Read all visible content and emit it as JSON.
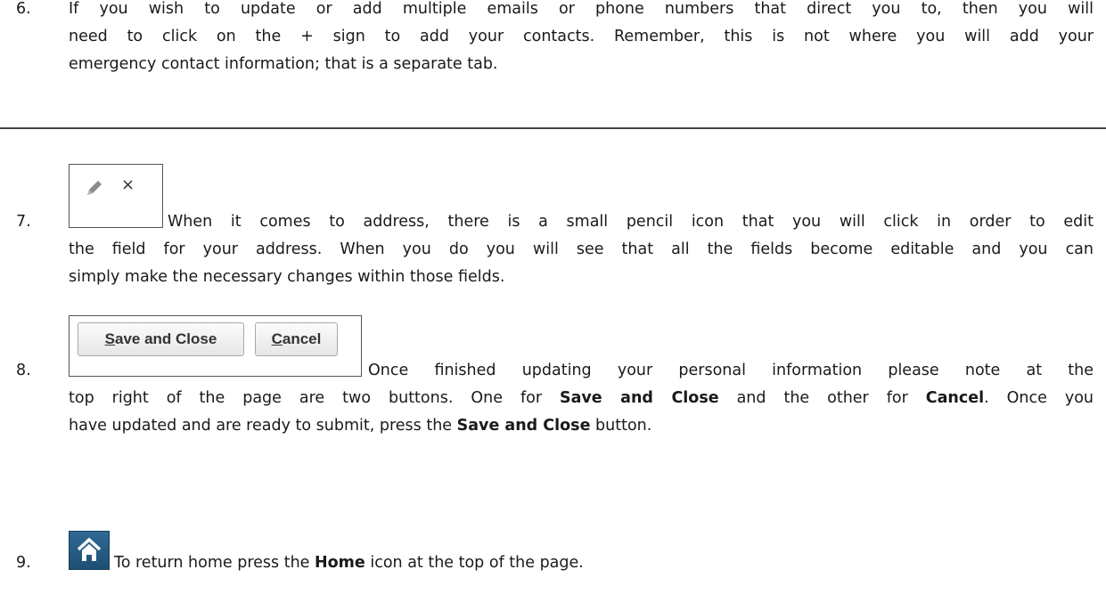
{
  "steps": [
    {
      "number": "6.",
      "lines": [
        "If you wish to update or add multiple emails or phone numbers that direct you to, then you will",
        "need to click on the + sign to add your contacts. Remember, this is not where you will add your",
        "emergency contact information; that is a separate tab."
      ]
    },
    {
      "number": "7.",
      "widget": {
        "close_glyph": "×"
      },
      "lines": [
        "When it comes to address, there is a small pencil icon that you will click in order to edit",
        "the field for your address. When you do you will see that all the fields become editable and you can",
        "simply make the necessary changes within those fields."
      ]
    },
    {
      "number": "8.",
      "widget": {
        "save_prefix": "S",
        "save_rest": "ave and Close",
        "cancel_prefix": "C",
        "cancel_rest": "ancel"
      },
      "line1": "Once finished updating your personal information please note at the",
      "line2_a": "top right of the page are two buttons. One for ",
      "line2_b": "Save and Close",
      "line2_c": " and the other for ",
      "line2_d": "Cancel",
      "line2_e": ". Once you",
      "line3_a": "have updated and are ready to submit, press the ",
      "line3_b": "Save and Close",
      "line3_c": " button."
    },
    {
      "number": "9.",
      "line_a": "To return home press the ",
      "line_b": "Home",
      "line_c": " icon at the top of the page."
    }
  ],
  "colors": {
    "home_icon_bg": "#1d4f73",
    "rule": "#444444"
  }
}
